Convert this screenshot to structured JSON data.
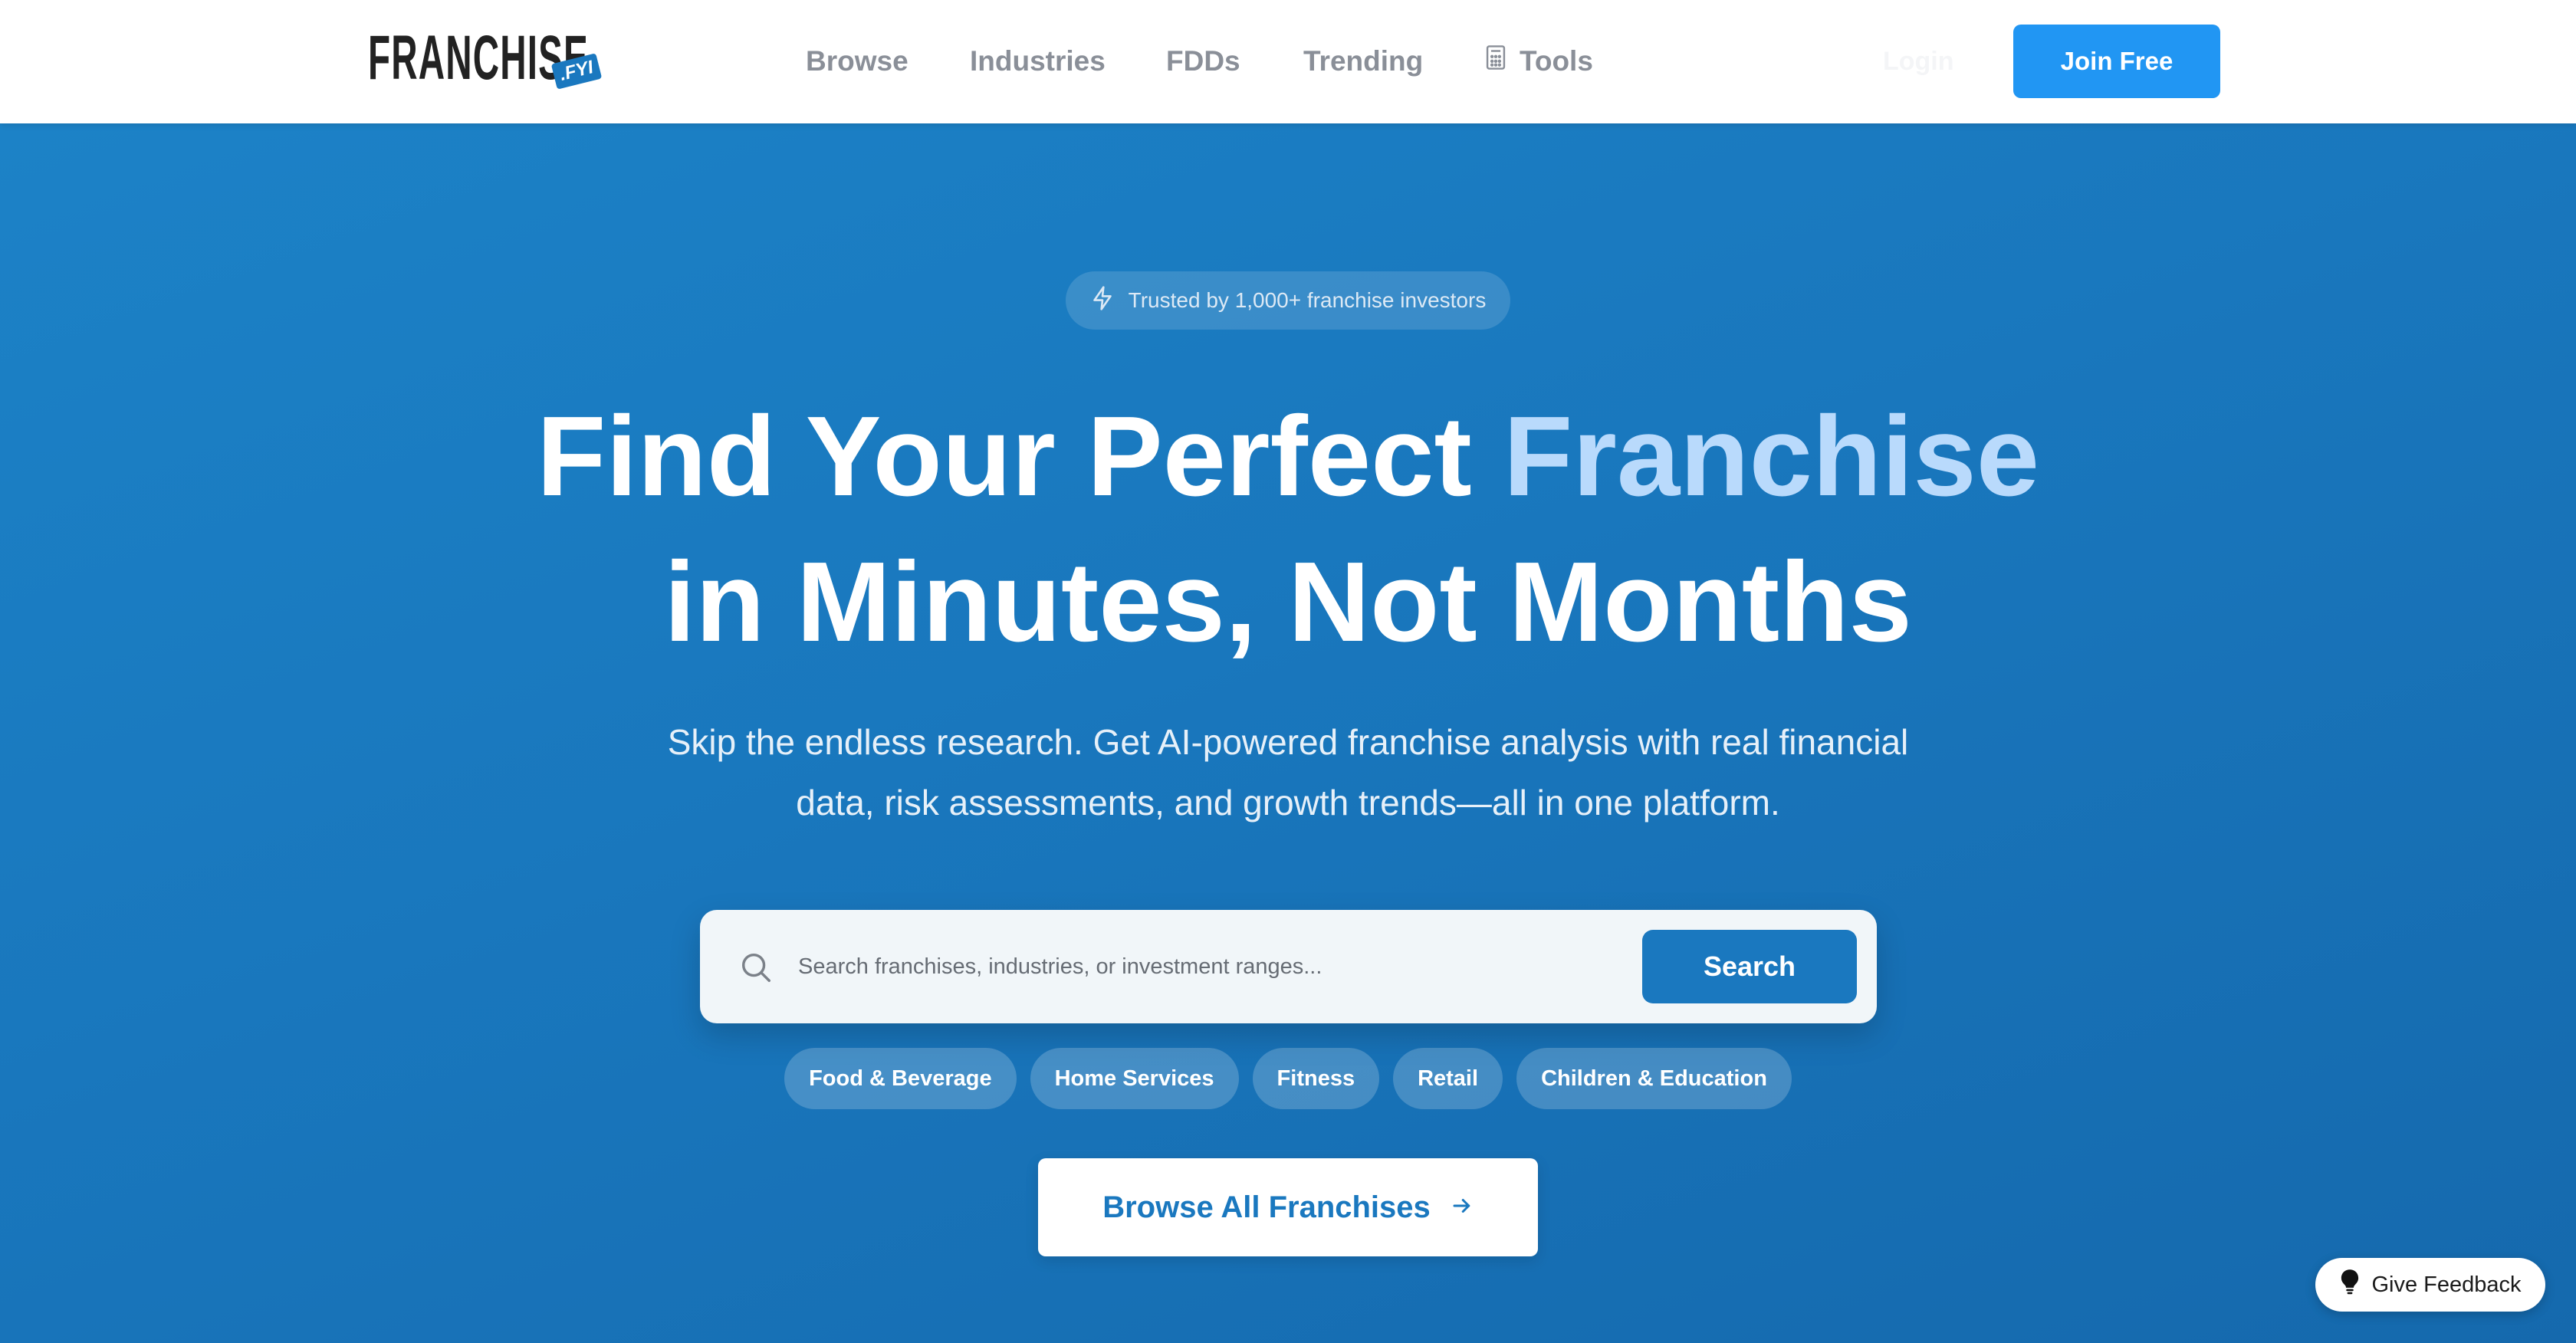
{
  "brand": {
    "name": "FRANCHISE",
    "tag": ".FYI",
    "accent_color": "#1a78bf",
    "primary_button_color": "#2196f3"
  },
  "nav": {
    "items": [
      {
        "label": "Browse"
      },
      {
        "label": "Industries"
      },
      {
        "label": "FDDs"
      },
      {
        "label": "Trending"
      },
      {
        "label": "Tools",
        "icon": "calculator-icon"
      }
    ],
    "login_label": "Login",
    "join_label": "Join Free"
  },
  "hero": {
    "trust_badge": {
      "icon": "lightning-icon",
      "text": "Trusted by 1,000+ franchise investors"
    },
    "headline_part1": "Find Your Perfect ",
    "headline_accent": "Franchise",
    "headline_line2": "in Minutes, Not Months",
    "subheadline_line1": "Skip the endless research. Get AI-powered franchise analysis with real financial",
    "subheadline_line2": "data, risk assessments, and growth trends—all in one platform.",
    "search": {
      "icon": "search-icon",
      "placeholder": "Search franchises, industries, or investment ranges...",
      "value": "",
      "button_label": "Search"
    },
    "categories": [
      "Food & Beverage",
      "Home Services",
      "Fitness",
      "Retail",
      "Children & Education"
    ],
    "browse_all_label": "Browse All Franchises",
    "browse_all_icon": "arrow-right-icon"
  },
  "feedback": {
    "icon": "lightbulb-icon",
    "label": "Give Feedback"
  }
}
